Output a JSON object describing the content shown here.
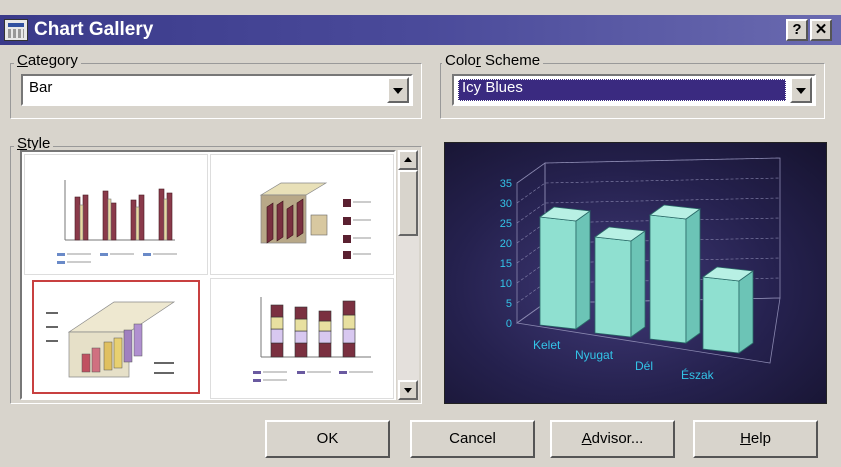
{
  "window": {
    "title": "Chart Gallery",
    "help_glyph": "?",
    "close_glyph": "✕"
  },
  "category": {
    "label_key": "C",
    "label_rest": "ategory",
    "value": "Bar"
  },
  "color_scheme": {
    "label_pre": "Colo",
    "label_key": "r",
    "label_post": " Scheme",
    "value": "Icy Blues"
  },
  "style": {
    "label_key": "S",
    "label_rest": "tyle",
    "thumbnails": [
      "3d-clustered-bar",
      "3d-stacked-depth-bar",
      "3d-perspective-bar",
      "stacked-bar"
    ],
    "selected_index": 2
  },
  "preview": {
    "type": "bar",
    "categories": [
      "Kelet",
      "Nyugat",
      "Dél",
      "Észak"
    ],
    "values": [
      27,
      24,
      31,
      18
    ],
    "y_ticks": [
      "0",
      "5",
      "10",
      "15",
      "20",
      "25",
      "30",
      "35"
    ],
    "ylim": [
      0,
      35
    ],
    "bar_color": "#8fe0d0",
    "label_color": "#33c4e8"
  },
  "chart_data": {
    "type": "bar",
    "categories": [
      "Kelet",
      "Nyugat",
      "Dél",
      "Észak"
    ],
    "values": [
      27,
      24,
      31,
      18
    ],
    "xlabel": "",
    "ylabel": "",
    "ylim": [
      0,
      35
    ]
  },
  "buttons": {
    "ok": "OK",
    "cancel": "Cancel",
    "advisor_key": "A",
    "advisor_rest": "dvisor...",
    "help_key": "H",
    "help_rest": "elp"
  },
  "colors": {
    "titlebar": "#3a3a8a",
    "selection": "#3a2a80",
    "dialog": "#d8d4cc"
  }
}
